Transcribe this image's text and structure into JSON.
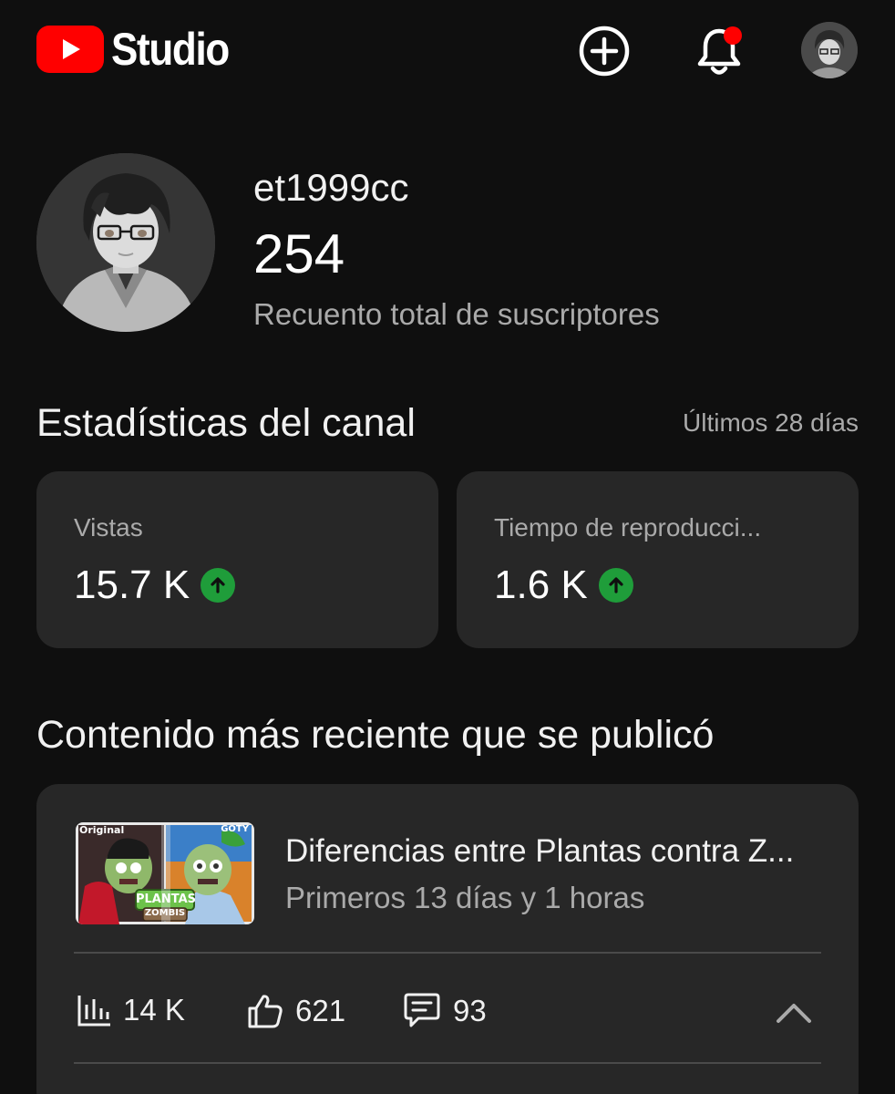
{
  "header": {
    "logo_text": "Studio",
    "brand_color": "#ff0000"
  },
  "channel": {
    "name": "et1999cc",
    "subscriber_count": "254",
    "subscriber_label": "Recuento total de suscriptores"
  },
  "stats": {
    "title": "Estadísticas del canal",
    "period": "Últimos 28 días",
    "cards": [
      {
        "label": "Vistas",
        "value": "15.7 K",
        "trend": "up"
      },
      {
        "label": "Tiempo de reproducci...",
        "value": "1.6 K",
        "trend": "up"
      }
    ],
    "trend_color": "#1f9d3a"
  },
  "latest": {
    "title": "Contenido más reciente que se publicó",
    "video": {
      "title": "Diferencias entre Plantas contra Z...",
      "subtitle": "Primeros 13 días y 1 horas",
      "thumbnail_text": {
        "left_tag": "Original",
        "right_tag": "GOTY",
        "logo_line1": "PLANTAS",
        "logo_line2": "ZOMBIS"
      },
      "metrics": {
        "views": "14 K",
        "likes": "621",
        "comments": "93"
      }
    }
  },
  "icons": [
    "youtube-play-icon",
    "create-plus-icon",
    "bell-icon",
    "chart-icon",
    "thumbs-up-icon",
    "comment-icon",
    "chevron-up-icon",
    "arrow-up-icon"
  ]
}
